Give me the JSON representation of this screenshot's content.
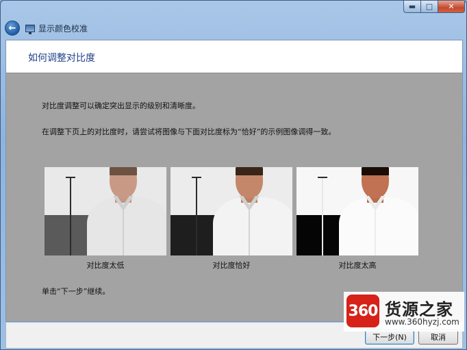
{
  "window": {
    "title": "显示颜色校准",
    "controls": {
      "minimize": "▬",
      "maximize": "□",
      "close": "✕"
    }
  },
  "nav": {
    "back_icon": "←"
  },
  "header": {
    "title": "如何调整对比度"
  },
  "body": {
    "intro": "对比度调整可以确定突出显示的级别和清晰度。",
    "instruction": "在调整下页上的对比度时，请尝试将图像与下面对比度标为“恰好”的示例图像调得一致。",
    "footer_note": "单击“下一步”继续。"
  },
  "samples": [
    {
      "caption": "对比度太低"
    },
    {
      "caption": "对比度恰好"
    },
    {
      "caption": "对比度太高"
    }
  ],
  "buttons": {
    "next": "下一步(N)",
    "cancel": "取消"
  },
  "watermark": {
    "logo": "360",
    "name": "货源之家",
    "url": "www.360hyzj.com"
  }
}
